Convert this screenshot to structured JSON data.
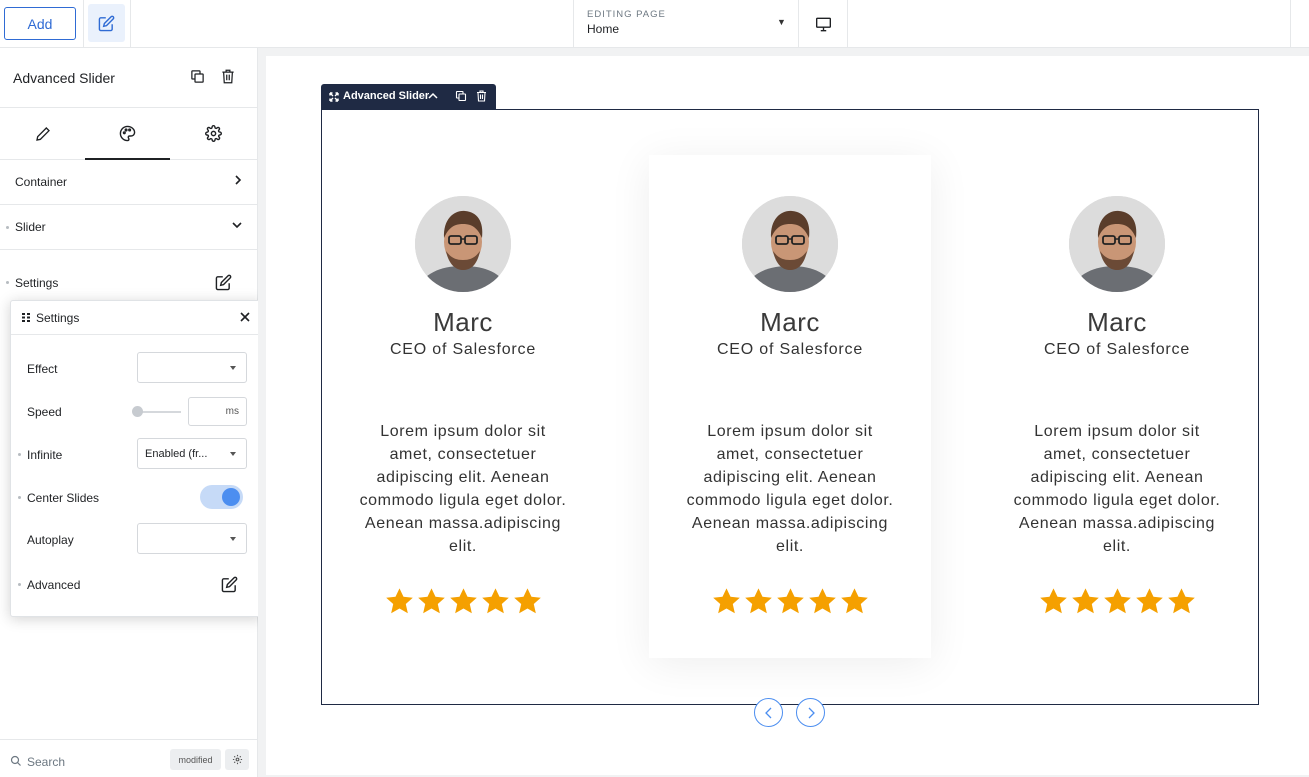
{
  "topbar": {
    "add_label": "Add",
    "editing_label": "EDITING PAGE",
    "editing_value": "Home"
  },
  "panel": {
    "title": "Advanced Slider",
    "sections": {
      "container": "Container",
      "slider": "Slider",
      "settings": "Settings"
    },
    "footer": {
      "search_placeholder": "Search",
      "modified_badge": "modified"
    }
  },
  "popup": {
    "title": "Settings",
    "rows": {
      "effect": "Effect",
      "speed": "Speed",
      "speed_unit": "ms",
      "infinite": "Infinite",
      "infinite_value": "Enabled (fr...",
      "center_slides": "Center Slides",
      "center_slides_on": true,
      "autoplay": "Autoplay",
      "advanced": "Advanced"
    }
  },
  "canvas": {
    "widget_label": "Advanced Slider",
    "cards": [
      {
        "name": "Marc",
        "role": "CEO of Salesforce",
        "text": "Lorem ipsum dolor sit amet, consectetuer adipiscing elit. Aenean commodo ligula eget dolor. Aenean massa.adipiscing elit.",
        "rating": 5
      },
      {
        "name": "Marc",
        "role": "CEO of Salesforce",
        "text": "Lorem ipsum dolor sit amet, consectetuer adipiscing elit. Aenean commodo ligula eget dolor. Aenean massa.adipiscing elit.",
        "rating": 5
      },
      {
        "name": "Marc",
        "role": "CEO of Salesforce",
        "text": "Lorem ipsum dolor sit amet, consectetuer adipiscing elit. Aenean commodo ligula eget dolor. Aenean massa.adipiscing elit.",
        "rating": 5
      }
    ]
  },
  "colors": {
    "accent": "#2f6bd4",
    "toggle": "#4c8ef0",
    "star": "#f5a000",
    "widget_dark": "#1f2a44"
  },
  "icons": {
    "edit": "pencil-square-icon",
    "copy": "copy-icon",
    "trash": "trash-icon",
    "pencil": "pencil-icon",
    "palette": "palette-icon",
    "gear": "gear-icon",
    "desktop": "desktop-icon",
    "search": "search-icon",
    "close": "close-icon",
    "star": "star-icon"
  }
}
